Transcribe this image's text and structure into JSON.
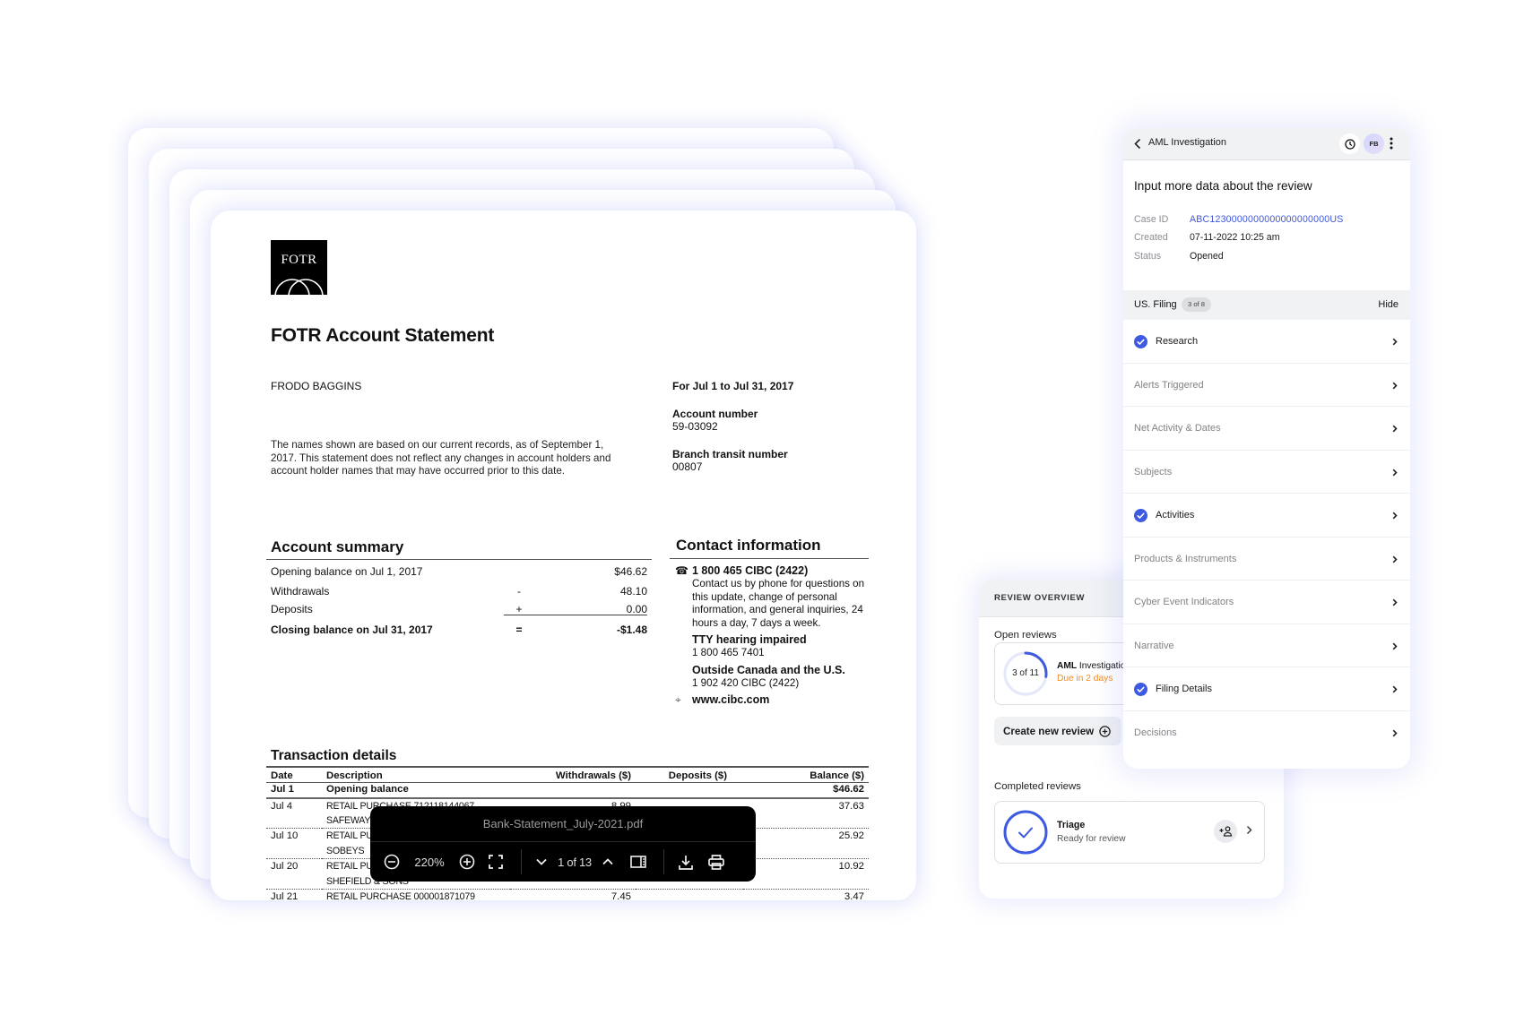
{
  "statement": {
    "logo_text": "FOTR",
    "title": "FOTR Account Statement",
    "holder_name": "FRODO BAGGINS",
    "notice": "The names shown are based on our current records, as of September 1, 2017. This statement does not reflect any changes in account holders and account holder names that may have occurred prior to this date.",
    "period": "For Jul 1 to Jul 31, 2017",
    "account_number_label": "Account number",
    "account_number": "59-03092",
    "branch_label": "Branch transit number",
    "branch_number": "00807",
    "summary": {
      "title": "Account summary",
      "rows": [
        {
          "label": "Opening balance on Jul 1, 2017",
          "op": "",
          "amount": "$46.62"
        },
        {
          "label": "Withdrawals",
          "op": "-",
          "amount": "48.10"
        },
        {
          "label": "Deposits",
          "op": "+",
          "amount": "0.00"
        },
        {
          "label": "Closing balance on Jul 31, 2017",
          "op": "=",
          "amount": "-$1.48"
        }
      ]
    },
    "contact": {
      "title": "Contact information",
      "phone": "1 800 465 CIBC (2422)",
      "phone_desc": "Contact us by phone for questions on this update, change of personal information, and general inquiries, 24 hours a day, 7 days a week.",
      "tty_label": "TTY hearing impaired",
      "tty_number": "1 800 465 7401",
      "outside_label": "Outside Canada and the U.S.",
      "outside_number": "1 902 420 CIBC (2422)",
      "website": "www.cibc.com"
    },
    "transactions": {
      "title": "Transaction details",
      "headers": [
        "Date",
        "Description",
        "Withdrawals ($)",
        "Deposits ($)",
        "Balance ($)"
      ],
      "opening": {
        "date": "Jul 1",
        "description": "Opening balance",
        "balance": "$46.62"
      },
      "rows": [
        {
          "date": "Jul 4",
          "line1": "RETAIL PURCHASE 712118144067",
          "line2": "SAFEWAY",
          "withdrawal": "8.99",
          "deposit": "",
          "balance": "37.63"
        },
        {
          "date": "Jul 10",
          "line1": "RETAIL PURCHASE",
          "line2": "SOBEYS",
          "withdrawal": "",
          "deposit": "",
          "balance": "25.92"
        },
        {
          "date": "Jul 20",
          "line1": "RETAIL PURCHASE",
          "line2": "SHEFIELD & SONS",
          "withdrawal": "",
          "deposit": "",
          "balance": "10.92"
        },
        {
          "date": "Jul 21",
          "line1": "RETAIL PURCHASE 000001871079",
          "line2": "",
          "withdrawal": "7.45",
          "deposit": "",
          "balance": "3.47"
        }
      ]
    }
  },
  "pdf_viewer": {
    "filename": "Bank-Statement_July-2021.pdf",
    "zoom": "220%",
    "page_indicator": "1 of 13",
    "current_page": 1,
    "total_pages": 13
  },
  "review_overview": {
    "header": "REVIEW OVERVIEW",
    "open_label": "Open reviews",
    "open_review": {
      "progress_text": "3 of 11",
      "progress_done": 3,
      "progress_total": 11,
      "title_bold": "AML",
      "title_rest": " Investigation",
      "due": "Due in 2 days"
    },
    "create_button": "Create new review",
    "completed_label": "Completed reviews",
    "completed_review": {
      "title": "Triage",
      "status": "Ready for review"
    }
  },
  "aml_panel": {
    "title": "AML Investigation",
    "avatar_initials": "FB",
    "subtitle": "Input more data about the review",
    "meta": [
      {
        "key": "Case ID",
        "value": "ABC1230000000000000000000US",
        "link": true
      },
      {
        "key": "Created",
        "value": "07-11-2022 10:25 am",
        "link": false
      },
      {
        "key": "Status",
        "value": "Opened",
        "link": false
      }
    ],
    "filing": {
      "label": "US. Filing",
      "badge": "3 of 8",
      "hide_label": "Hide"
    },
    "steps": [
      {
        "label": "Research",
        "done": true
      },
      {
        "label": "Alerts Triggered",
        "done": false
      },
      {
        "label": "Net Activity & Dates",
        "done": false
      },
      {
        "label": "Subjects",
        "done": false
      },
      {
        "label": "Activities",
        "done": true
      },
      {
        "label": "Products & Instruments",
        "done": false
      },
      {
        "label": "Cyber Event Indicators",
        "done": false
      },
      {
        "label": "Narrative",
        "done": false
      },
      {
        "label": "Filing Details",
        "done": true
      },
      {
        "label": "Decisions",
        "done": false
      }
    ]
  },
  "colors": {
    "accent_blue": "#3f56d8",
    "check_blue": "#3d5ae0",
    "due_orange": "#f08a1c",
    "card_glow": "#7882eb"
  }
}
